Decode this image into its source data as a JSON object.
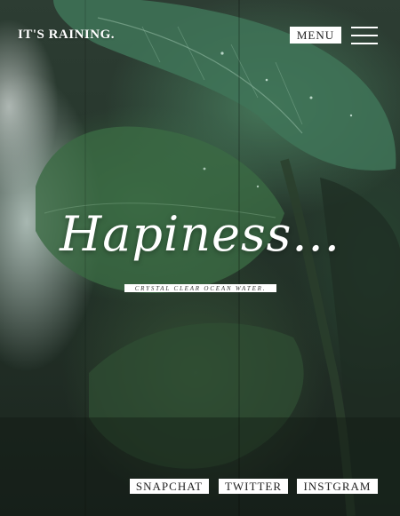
{
  "header": {
    "brand": "IT'S RAINING.",
    "menu_label": "MENU",
    "hamburger_icon": "hamburger-menu-icon"
  },
  "hero": {
    "background": "rain-soaked tropical leaves photo",
    "title": "Hapiness...",
    "tagline": "CRYSTAL CLEAR OCEAN WATER."
  },
  "social": {
    "links": [
      "SNAPCHAT",
      "TWITTER",
      "INSTGRAM"
    ]
  },
  "colors": {
    "text": "#ffffff",
    "button_bg": "#ffffff",
    "button_text": "#222222"
  }
}
